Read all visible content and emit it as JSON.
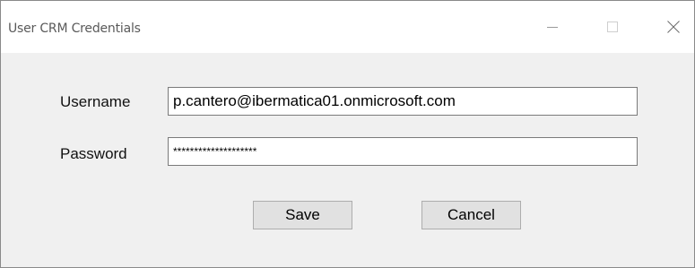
{
  "window": {
    "title": "User CRM Credentials",
    "controls": {
      "minimize_icon": "minimize-icon",
      "maximize_icon": "maximize-icon",
      "close_icon": "close-icon"
    }
  },
  "form": {
    "username_label": "Username",
    "username_value": "p.cantero@ibermatica01.onmicrosoft.com",
    "password_label": "Password",
    "password_masked": "********************"
  },
  "buttons": {
    "save_label": "Save",
    "cancel_label": "Cancel"
  }
}
